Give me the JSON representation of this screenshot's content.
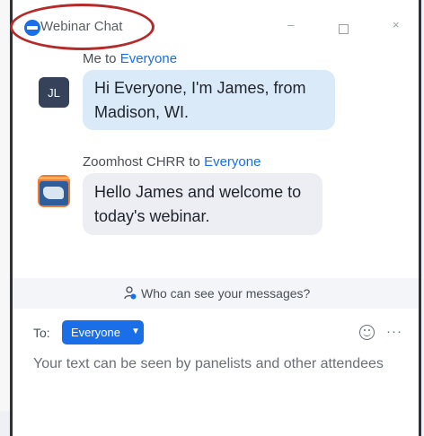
{
  "window": {
    "title": "Webinar Chat",
    "controls": {
      "minimize": "–",
      "close": "×"
    }
  },
  "messages": [
    {
      "from": "Me",
      "connector": " to ",
      "to": "Everyone",
      "avatar_initials": "JL",
      "text": "Hi Everyone, I'm James, from Madison, WI."
    },
    {
      "from": "Zoomhost CHRR",
      "connector": " to ",
      "to": "Everyone",
      "avatar_icon": "us-map-icon",
      "text": "Hello James and welcome to today's webinar."
    }
  ],
  "visibility": {
    "text": "Who can see your messages?"
  },
  "compose": {
    "to_label": "To:",
    "recipient": "Everyone",
    "placeholder": "Your text can be seen by panelists and other attendees",
    "more": "···"
  },
  "colors": {
    "accent": "#1a6ee8",
    "highlight_ring": "#b52a2a",
    "my_bubble": "#dbeaf8",
    "other_bubble": "#eceef3"
  }
}
